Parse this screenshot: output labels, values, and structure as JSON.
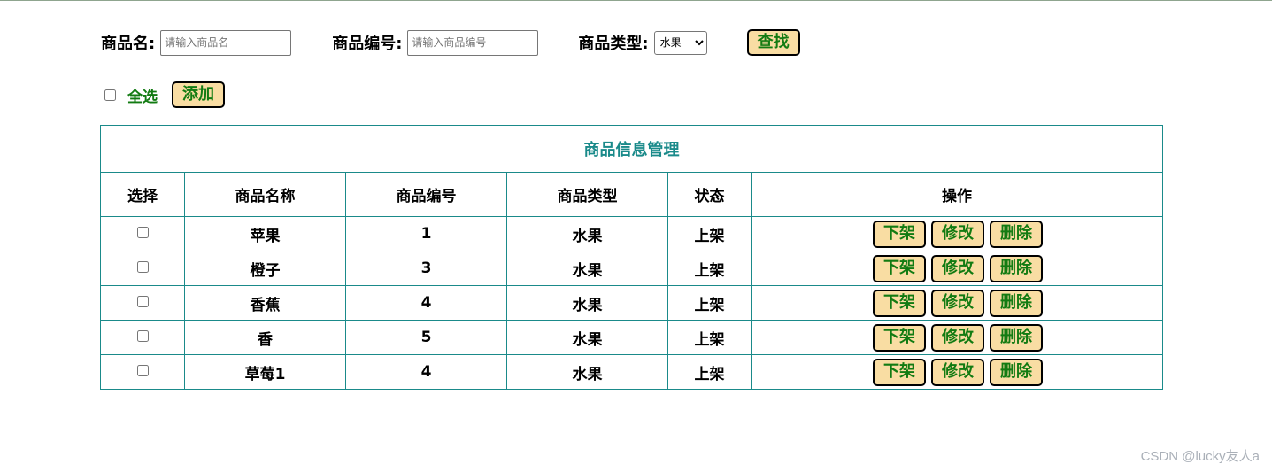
{
  "search": {
    "name_label": "商品名:",
    "name_placeholder": "请输入商品名",
    "name_value": "",
    "code_label": "商品编号:",
    "code_placeholder": "请输入商品编号",
    "code_value": "",
    "type_label": "商品类型:",
    "type_selected": "水果",
    "search_button": "查找"
  },
  "toolbar": {
    "select_all_label": "全选",
    "add_button": "添加"
  },
  "table": {
    "caption": "商品信息管理",
    "headers": [
      "选择",
      "商品名称",
      "商品编号",
      "商品类型",
      "状态",
      "操作"
    ],
    "rows": [
      {
        "name": "苹果",
        "code": "1",
        "type": "水果",
        "status": "上架"
      },
      {
        "name": "橙子",
        "code": "3",
        "type": "水果",
        "status": "上架"
      },
      {
        "name": "香蕉",
        "code": "4",
        "type": "水果",
        "status": "上架"
      },
      {
        "name": "香",
        "code": "5",
        "type": "水果",
        "status": "上架"
      },
      {
        "name": "草莓1",
        "code": "4",
        "type": "水果",
        "status": "上架"
      }
    ],
    "actions": {
      "off_shelf": "下架",
      "edit": "修改",
      "delete": "删除"
    }
  },
  "watermark": "CSDN @lucky友人a",
  "colors": {
    "accent_green": "#127b12",
    "button_bg": "#f9dda3",
    "table_border": "#1a8a8a"
  }
}
